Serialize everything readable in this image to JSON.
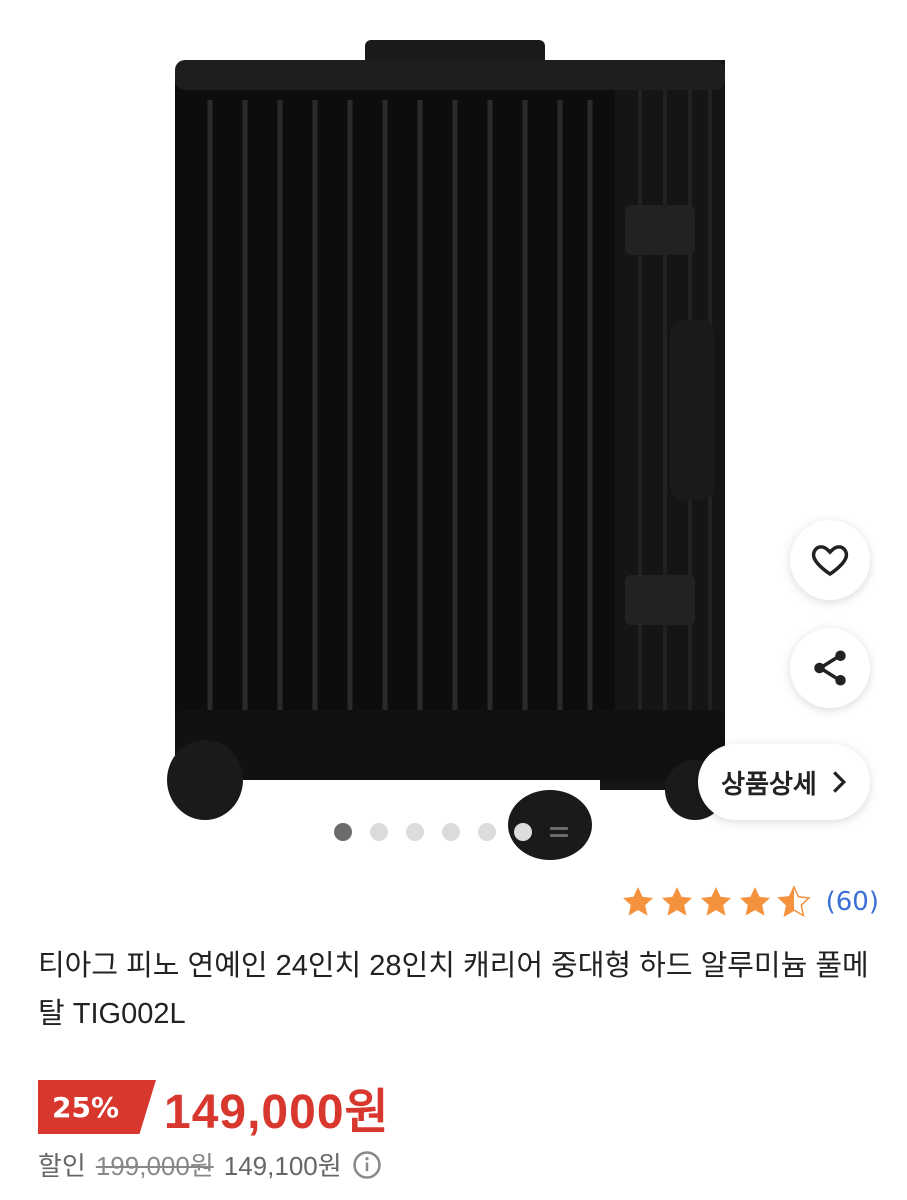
{
  "product": {
    "title": "티아그 피노 연예인 24인치 28인치 캐리어 중대형 하드 알루미늄 풀메탈 TIG002L",
    "image_icon": "black-aluminum-suitcase"
  },
  "gallery": {
    "dots_total": 6,
    "active_index": 0
  },
  "actions": {
    "detail_label": "상품상세",
    "like_icon": "heart-icon",
    "share_icon": "share-icon"
  },
  "rating": {
    "score": 4.5,
    "review_count": "(60)",
    "star_color": "#f5923e"
  },
  "pricing": {
    "discount_badge": "25%",
    "price": "149,000원",
    "discount_label": "할인",
    "original_price": "199,000원",
    "alt_price": "149,100원",
    "accent_color": "#d8372d"
  }
}
